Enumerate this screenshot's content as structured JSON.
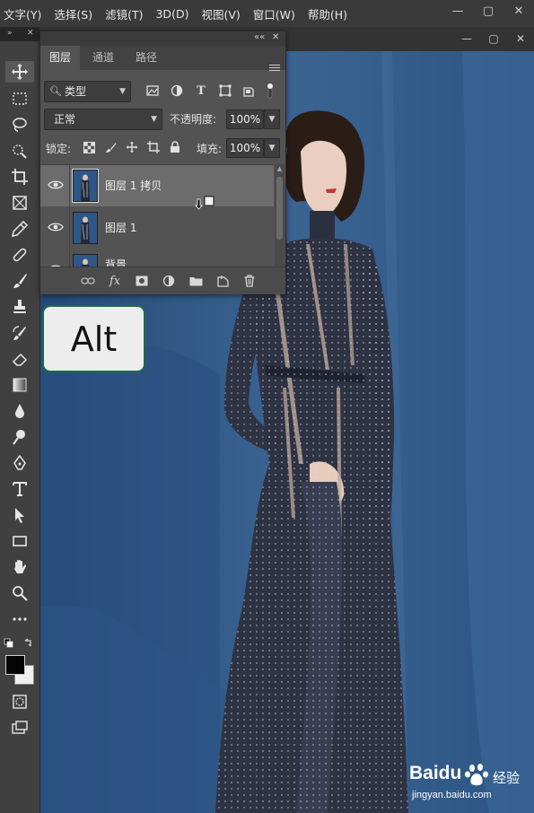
{
  "menu": [
    "文字(Y)",
    "选择(S)",
    "滤镜(T)",
    "3D(D)",
    "视图(V)",
    "窗口(W)",
    "帮助(H)"
  ],
  "window_controls": {
    "minimize": "—",
    "restore": "▢",
    "close": "✕"
  },
  "toolbar_header": {
    "collapse": "»",
    "close": "✕"
  },
  "layers_panel": {
    "header_controls": {
      "collapse": "««",
      "close": "✕"
    },
    "tabs": [
      "图层",
      "通道",
      "路径"
    ],
    "active_tab": "图层",
    "filter": {
      "label": "类型"
    },
    "blend_mode": "正常",
    "opacity_label": "不透明度:",
    "opacity_value": "100%",
    "lock_label": "锁定:",
    "fill_label": "填充:",
    "fill_value": "100%",
    "layers": [
      {
        "name": "图层 1 拷贝",
        "selected": true,
        "visible": true
      },
      {
        "name": "图层 1",
        "selected": false,
        "visible": true
      },
      {
        "name": "背景",
        "selected": false,
        "visible": true
      }
    ],
    "footer_icons": [
      "link-icon",
      "fx-icon",
      "mask-icon",
      "adjustment-icon",
      "folder-icon",
      "new-layer-icon",
      "trash-icon"
    ]
  },
  "key_hint": "Alt",
  "watermark": {
    "logo": "Baidu",
    "cn": "经验",
    "url": "jingyan.baidu.com"
  },
  "colors": {
    "accent_border": "#1e6b4a",
    "canvas_blue": "#2f5683",
    "panel_bg": "#535353"
  }
}
